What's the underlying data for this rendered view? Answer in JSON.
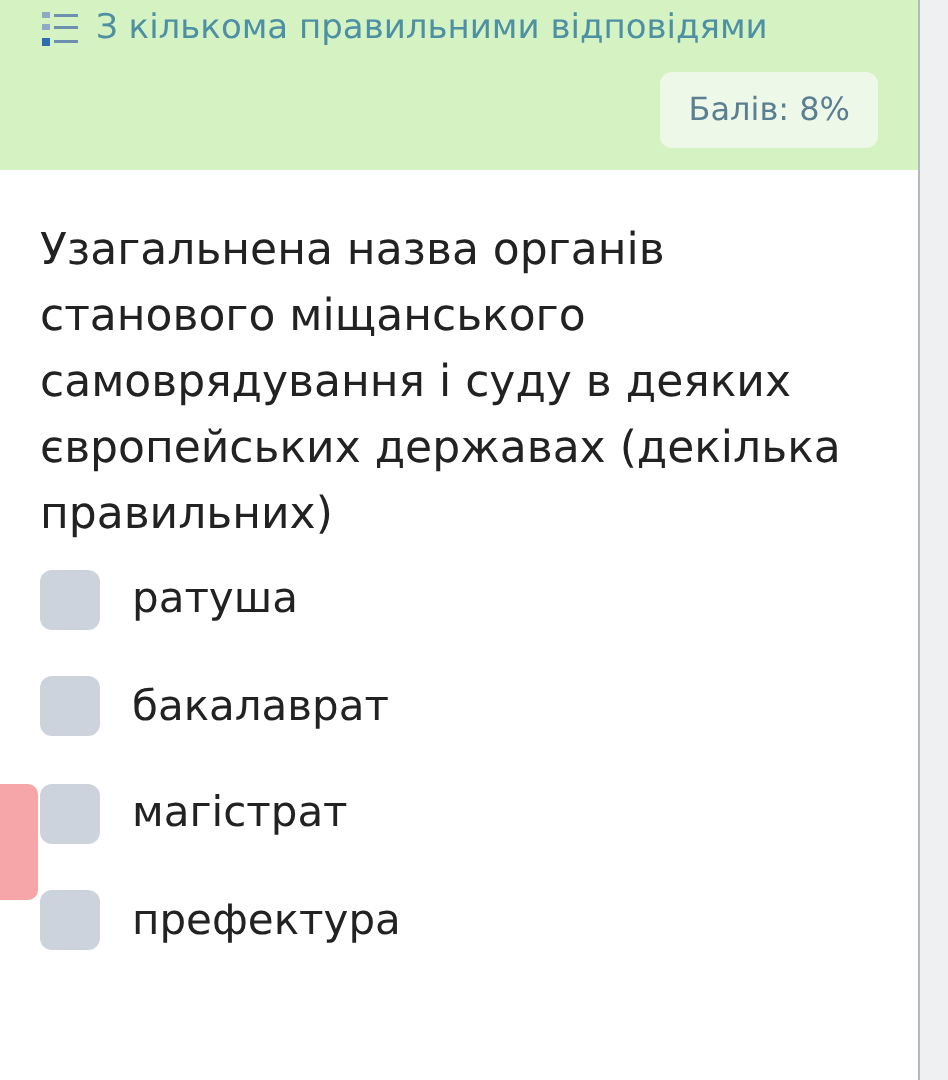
{
  "header": {
    "type_label": "З кількома правильними відповідями",
    "score": "Балів: 8%"
  },
  "question": "Узагальнена назва органів станового міщанського самоврядування і суду в деяких європейських державах (декілька правильних)",
  "options": [
    {
      "label": "ратуша",
      "checked": false
    },
    {
      "label": "бакалаврат",
      "checked": false
    },
    {
      "label": "магістрат",
      "checked": false
    },
    {
      "label": "префектура",
      "checked": false
    }
  ]
}
